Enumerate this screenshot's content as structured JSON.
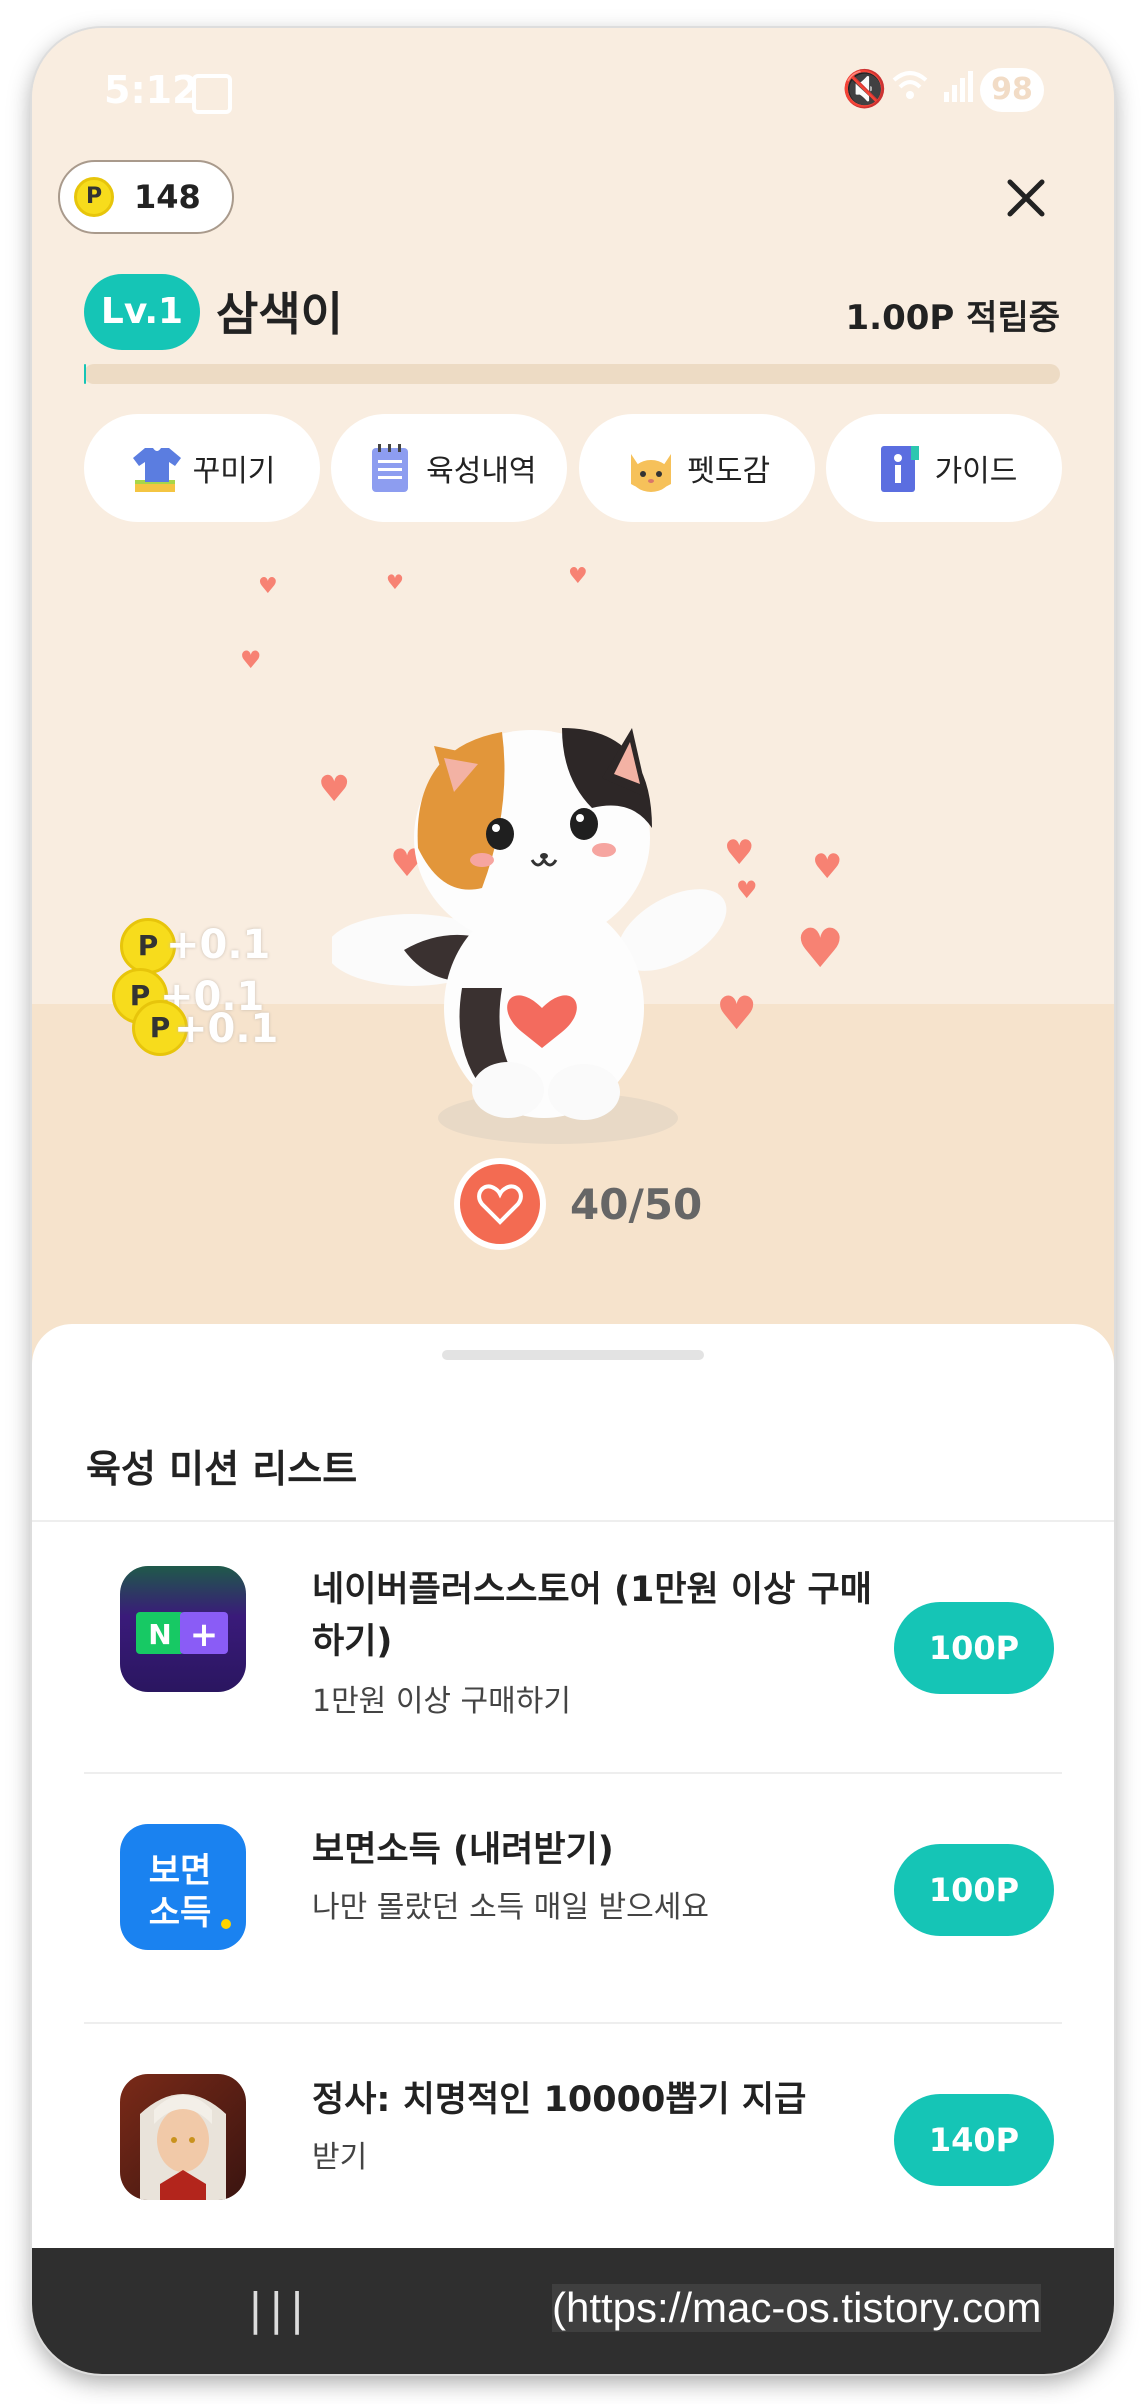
{
  "status_bar": {
    "time": "5:12",
    "battery": "98"
  },
  "header": {
    "points": "148",
    "coin_symbol": "P",
    "close_icon": "close-icon"
  },
  "pet": {
    "level": "Lv.1",
    "name": "삼색이",
    "earning_rate": "1.00P 적립중",
    "level_progress": 0.002
  },
  "menu": [
    {
      "label": "꾸미기",
      "icon": "shirt-icon"
    },
    {
      "label": "육성내역",
      "icon": "notepad-icon"
    },
    {
      "label": "펫도감",
      "icon": "cat-face-icon"
    },
    {
      "label": "가이드",
      "icon": "info-book-icon"
    }
  ],
  "floating_rewards": [
    "+0.1",
    "+0.1",
    "+0.1"
  ],
  "affection": {
    "value": "40/50"
  },
  "missions_panel": {
    "title": "육성 미션 리스트",
    "items": [
      {
        "name": "네이버플러스스토어 (1만원 이상 구매하기)",
        "desc": "1만원 이상 구매하기",
        "points": "100P",
        "icon_text": "N +"
      },
      {
        "name": "보면소득 (내려받기)",
        "desc": "나만 몰랐던 소득 매일 받으세요",
        "points": "100P",
        "icon_text": "보면 소득"
      },
      {
        "name": "정사: 치명적인 10000뽑기 지급",
        "desc": "받기",
        "points": "140P",
        "icon_text": ""
      }
    ]
  },
  "nav_bar": {
    "recent_apps": "|||",
    "watermark": "(https://mac-os.tistory.com"
  },
  "colors": {
    "accent": "#15c5b6",
    "heart": "#f78273",
    "background": "#f9ede0"
  }
}
